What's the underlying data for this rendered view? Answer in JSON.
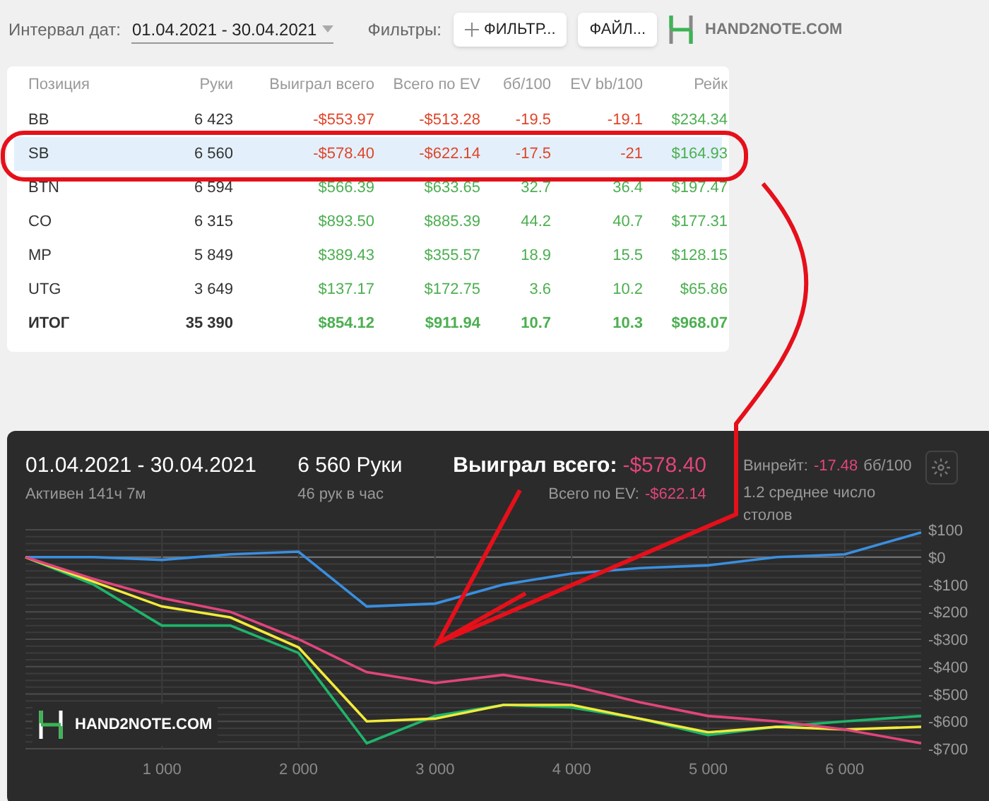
{
  "toolbar": {
    "date_label": "Интервал дат:",
    "date_range": "01.04.2021 - 30.04.2021",
    "filters_label": "Фильтры:",
    "filter_button": "ФИЛЬТР...",
    "file_button": "ФАЙЛ...",
    "logo": "HAND2NOTE.COM"
  },
  "table": {
    "columns": [
      "Позиция",
      "Руки",
      "Выиграл всего",
      "Всего по EV",
      "бб/100",
      "EV bb/100",
      "Рейк"
    ],
    "rows": [
      {
        "kind": "position",
        "selected": false,
        "position": "BB",
        "hands": "6 423",
        "values": [
          {
            "text": "-$553.97",
            "color": "#e0452a"
          },
          {
            "text": "-$513.28",
            "color": "#e0452a"
          },
          {
            "text": "-19.5",
            "color": "#e0452a"
          },
          {
            "text": "-19.1",
            "color": "#e0452a"
          },
          {
            "text": "$234.34",
            "color": "#4caf50"
          }
        ]
      },
      {
        "kind": "position",
        "selected": true,
        "position": "SB",
        "hands": "6 560",
        "values": [
          {
            "text": "-$578.40",
            "color": "#e0452a"
          },
          {
            "text": "-$622.14",
            "color": "#e0452a"
          },
          {
            "text": "-17.5",
            "color": "#e0452a"
          },
          {
            "text": "-21",
            "color": "#e0452a"
          },
          {
            "text": "$164.93",
            "color": "#4caf50"
          }
        ]
      },
      {
        "kind": "position",
        "selected": false,
        "position": "BTN",
        "hands": "6 594",
        "values": [
          {
            "text": "$566.39",
            "color": "#4caf50"
          },
          {
            "text": "$633.65",
            "color": "#4caf50"
          },
          {
            "text": "32.7",
            "color": "#4caf50"
          },
          {
            "text": "36.4",
            "color": "#4caf50"
          },
          {
            "text": "$197.47",
            "color": "#4caf50"
          }
        ]
      },
      {
        "kind": "position",
        "selected": false,
        "position": "CO",
        "hands": "6 315",
        "values": [
          {
            "text": "$893.50",
            "color": "#4caf50"
          },
          {
            "text": "$885.39",
            "color": "#4caf50"
          },
          {
            "text": "44.2",
            "color": "#4caf50"
          },
          {
            "text": "40.7",
            "color": "#4caf50"
          },
          {
            "text": "$177.31",
            "color": "#4caf50"
          }
        ]
      },
      {
        "kind": "position",
        "selected": false,
        "position": "MP",
        "hands": "5 849",
        "values": [
          {
            "text": "$389.43",
            "color": "#4caf50"
          },
          {
            "text": "$355.57",
            "color": "#4caf50"
          },
          {
            "text": "18.9",
            "color": "#4caf50"
          },
          {
            "text": "15.5",
            "color": "#4caf50"
          },
          {
            "text": "$128.15",
            "color": "#4caf50"
          }
        ]
      },
      {
        "kind": "position",
        "selected": false,
        "position": "UTG",
        "hands": "3 649",
        "values": [
          {
            "text": "$137.17",
            "color": "#4caf50"
          },
          {
            "text": "$172.75",
            "color": "#4caf50"
          },
          {
            "text": "3.6",
            "color": "#4caf50"
          },
          {
            "text": "10.2",
            "color": "#4caf50"
          },
          {
            "text": "$65.86",
            "color": "#4caf50"
          }
        ]
      },
      {
        "kind": "total",
        "selected": false,
        "position": "ИТОГ",
        "hands": "35 390",
        "values": [
          {
            "text": "$854.12",
            "color": "#4caf50"
          },
          {
            "text": "$911.94",
            "color": "#4caf50"
          },
          {
            "text": "10.7",
            "color": "#4caf50"
          },
          {
            "text": "10.3",
            "color": "#4caf50"
          },
          {
            "text": "$968.07",
            "color": "#4caf50"
          }
        ]
      }
    ]
  },
  "graph_panel": {
    "date_range": "01.04.2021 - 30.04.2021",
    "active": "Активен 141ч 7м",
    "hands": "6 560 Руки",
    "hands_rate": "46 рук в час",
    "won_label": "Выиграл всего:",
    "won_value": "-$578.40",
    "ev_label": "Всего по EV:",
    "ev_value": "-$622.14",
    "winrate_label": "Винрейт:",
    "winrate_value": "-17.48",
    "winrate_unit": "бб/100",
    "tables": "1.2 среднее число столов",
    "logo": "HAND2NOTE.COM",
    "chart_data": {
      "type": "line",
      "grid": true,
      "x": [
        0,
        500,
        1000,
        1500,
        2000,
        2500,
        3000,
        3500,
        4000,
        4500,
        5000,
        5500,
        6000,
        6560
      ],
      "series": [
        {
          "color": "#3a8fe0",
          "values": [
            0,
            0,
            -10,
            10,
            20,
            -180,
            -170,
            -100,
            -60,
            -40,
            -30,
            0,
            10,
            90
          ]
        },
        {
          "color": "#1fb56a",
          "values": [
            0,
            -100,
            -250,
            -250,
            -350,
            -680,
            -580,
            -540,
            -550,
            -590,
            -650,
            -620,
            -600,
            -580
          ]
        },
        {
          "color": "#f2ea3a",
          "values": [
            0,
            -90,
            -180,
            -220,
            -330,
            -600,
            -590,
            -540,
            -540,
            -590,
            -640,
            -620,
            -630,
            -620
          ]
        },
        {
          "color": "#e0457b",
          "values": [
            0,
            -80,
            -150,
            -200,
            -300,
            -420,
            -460,
            -430,
            -470,
            -530,
            -580,
            -600,
            -630,
            -680
          ]
        }
      ],
      "xlim": [
        0,
        6560
      ],
      "ylim": [
        -700,
        100
      ],
      "xticks": [
        {
          "value": 1000,
          "label": "1 000"
        },
        {
          "value": 2000,
          "label": "2 000"
        },
        {
          "value": 3000,
          "label": "3 000"
        },
        {
          "value": 4000,
          "label": "4 000"
        },
        {
          "value": 5000,
          "label": "5 000"
        },
        {
          "value": 6000,
          "label": "6 000"
        }
      ],
      "yticks": [
        {
          "value": 100,
          "label": "$100"
        },
        {
          "value": 0,
          "label": "$0"
        },
        {
          "value": -100,
          "label": "-$100"
        },
        {
          "value": -200,
          "label": "-$200"
        },
        {
          "value": -300,
          "label": "-$300"
        },
        {
          "value": -400,
          "label": "-$400"
        },
        {
          "value": -500,
          "label": "-$500"
        },
        {
          "value": -600,
          "label": "-$600"
        },
        {
          "value": -700,
          "label": "-$700"
        }
      ]
    }
  }
}
